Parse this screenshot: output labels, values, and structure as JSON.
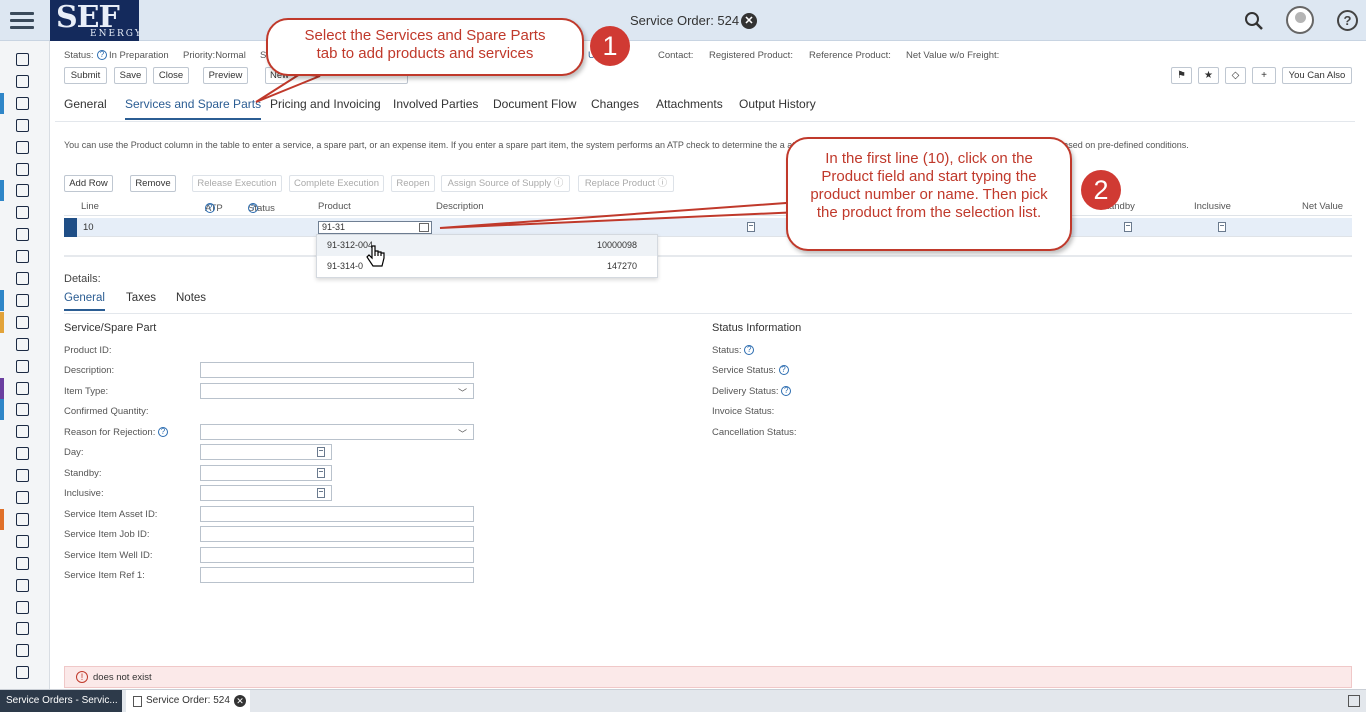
{
  "shell": {
    "title": "Service Order: 524",
    "logo_main": "SEF",
    "logo_sub": "ENERGY"
  },
  "header": {
    "status_label": "Status:",
    "status_value": "In Preparation",
    "priority": "Priority:Normal",
    "su": "Su",
    "customer_frag": "U INC.",
    "contact": "Contact:",
    "registered_product": "Registered Product:",
    "reference_product": "Reference Product:",
    "net_value": "Net Value w/o Freight:"
  },
  "toolbar": {
    "submit": "Submit",
    "save": "Save",
    "close": "Close",
    "preview": "Preview",
    "new": "New",
    "you_can_also": "You Can Also"
  },
  "tabs": [
    "General",
    "Services and Spare Parts",
    "Pricing and Invoicing",
    "Involved Parties",
    "Document Flow",
    "Changes",
    "Attachments",
    "Output History"
  ],
  "info_text": "You can use the Product column in the table to enter a service, a spare part, or an expense item. If you enter a spare part item, the system performs an ATP check to determine the a                                                                                                                                     ation is triggered. The warranty coverage is automatically set and is based on pre-defined conditions.",
  "grid_toolbar": {
    "add_row": "Add Row",
    "remove": "Remove",
    "release_execution": "Release Execution",
    "complete_execution": "Complete Execution",
    "reopen": "Reopen",
    "assign_source": "Assign Source of Supply",
    "replace_product": "Replace Product"
  },
  "grid": {
    "columns": [
      "Line",
      "ATP",
      "Status",
      "Product",
      "Description",
      "Standby",
      "Inclusive",
      "Net Value"
    ],
    "row": {
      "line": "10",
      "product": "91-31"
    }
  },
  "suggestions": [
    {
      "code": "91-312-004",
      "id": "10000098"
    },
    {
      "code": "91-314-0",
      "id": "147270"
    }
  ],
  "details": {
    "label": "Details:",
    "tabs": [
      "General",
      "Taxes",
      "Notes"
    ],
    "left_title": "Service/Spare Part",
    "right_title": "Status Information",
    "fields": {
      "product_id": "Product ID:",
      "description": "Description:",
      "item_type": "Item Type:",
      "confirmed_quantity": "Confirmed Quantity:",
      "reason_rejection": "Reason for Rejection:",
      "day": "Day:",
      "standby": "Standby:",
      "inclusive": "Inclusive:",
      "asset_id": "Service Item Asset ID:",
      "job_id": "Service Item Job ID:",
      "well_id": "Service Item Well ID:",
      "ref1": "Service Item Ref 1:"
    },
    "status_fields": {
      "status": "Status:",
      "service_status": "Service Status:",
      "delivery_status": "Delivery Status:",
      "invoice_status": "Invoice Status:",
      "cancellation_status": "Cancellation Status:"
    }
  },
  "message": "does not exist",
  "taskbar": {
    "item1": "Service Orders - Servic...",
    "item2": "Service Order: 524"
  },
  "callouts": {
    "c1_text": "Select the Services and Spare Parts tab to add products and services",
    "c1_num": "1",
    "c2_text": "In the first line (10), click on the Product field and start typing the product number or name.  Then pick the product from the selection list.",
    "c2_num": "2"
  },
  "colors": {
    "shell_bg": "#dde7f2",
    "accent": "#2b5d93",
    "callout_red": "#c0392b",
    "logo_bg": "#142a5c"
  }
}
